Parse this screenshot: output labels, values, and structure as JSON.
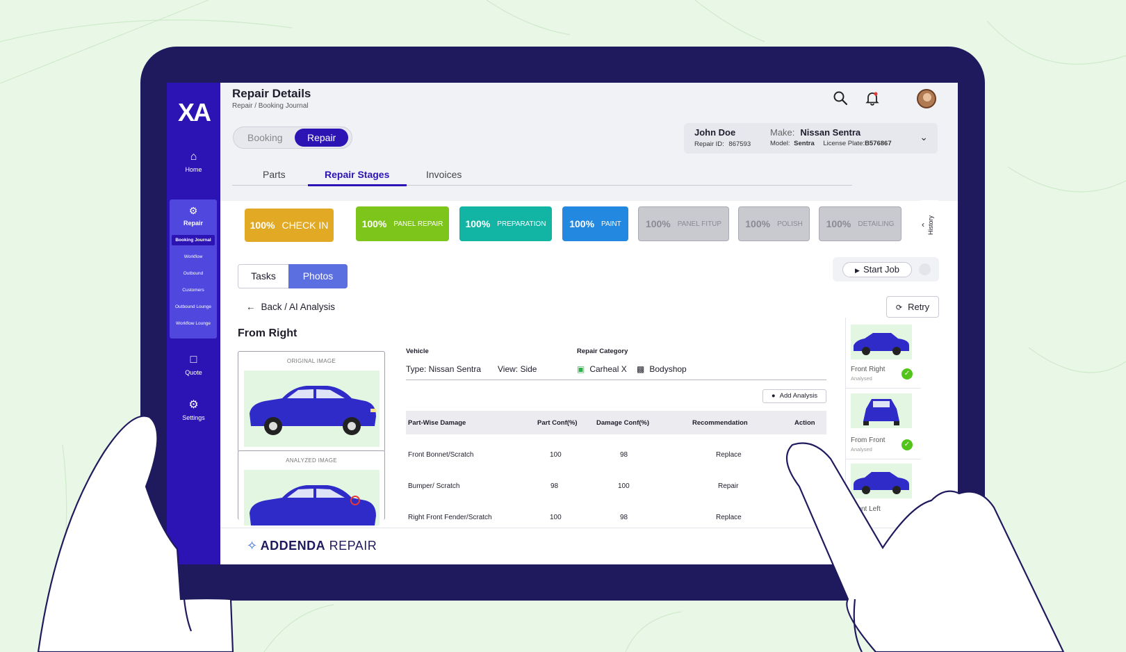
{
  "sidebar": {
    "logo": "XA",
    "home": "Home",
    "repair": "Repair",
    "repair_items": [
      "Booking Journal",
      "Workflow",
      "Outbound",
      "Customers",
      "Outbound Lounge",
      "Workflow Lounge"
    ],
    "quote": "Quote",
    "settings": "Settings"
  },
  "header": {
    "title": "Repair Details",
    "breadcrumb": "Repair / Booking Journal",
    "icons": [
      "search-icon",
      "bell-icon",
      "avatar"
    ]
  },
  "toggle": {
    "booking": "Booking",
    "repair": "Repair"
  },
  "customer": {
    "name": "John Doe",
    "repair_id_label": "Repair ID:",
    "repair_id": "867593",
    "make_label": "Make:",
    "make": "Nissan Sentra",
    "model_label": "Model:",
    "model": "Sentra",
    "plate_label": "License Plate:",
    "plate": "B576867"
  },
  "tabs": {
    "parts": "Parts",
    "stages": "Repair Stages",
    "invoices": "Invoices"
  },
  "stages": [
    {
      "pct": "100%",
      "label": "CHECK IN",
      "color": "#e2a924"
    },
    {
      "pct": "100%",
      "label": "PANEL REPAIR",
      "color": "#7ec51b"
    },
    {
      "pct": "100%",
      "label": "PREPARATION",
      "color": "#12b5a4"
    },
    {
      "pct": "100%",
      "label": "PAINT",
      "color": "#2288e0"
    },
    {
      "pct": "100%",
      "label": "PANEL FITUP",
      "color": "#c9c9d0"
    },
    {
      "pct": "100%",
      "label": "POLISH",
      "color": "#c9c9d0"
    },
    {
      "pct": "100%",
      "label": "DETAILING",
      "color": "#c9c9d0"
    }
  ],
  "history": "History",
  "segment": {
    "tasks": "Tasks",
    "photos": "Photos"
  },
  "start_job": "Start Job",
  "retry": "Retry",
  "back": "Back / AI Analysis",
  "view_title": "From Right",
  "original_caption": "ORIGINAL IMAGE",
  "analyzed_caption": "ANALYZED IMAGE",
  "vehicle": {
    "label": "Vehicle",
    "type": "Type: Nissan Sentra",
    "view": "View: Side"
  },
  "repair_category": {
    "label": "Repair Category",
    "carheal": "Carheal X",
    "bodyshop": "Bodyshop"
  },
  "add_analysis": "Add Analysis",
  "table": {
    "headers": [
      "Part-Wise Damage",
      "Part Conf(%)",
      "Damage Conf(%)",
      "Recommendation",
      "Action"
    ],
    "rows": [
      [
        "Front Bonnet/Scratch",
        "100",
        "98",
        "Replace"
      ],
      [
        "Bumper/ Scratch",
        "98",
        "100",
        "Repair"
      ],
      [
        "Right Front Fender/Scratch",
        "100",
        "98",
        "Replace"
      ]
    ]
  },
  "thumbnails": [
    {
      "name": "Front Right",
      "status": "Analysed"
    },
    {
      "name": "From Front",
      "status": "Analysed"
    },
    {
      "name": "Front Left",
      "status": ""
    }
  ],
  "footer": {
    "brand_bold": "ADDENDA",
    "brand_light": "REPAIR"
  },
  "colors": {
    "brand": "#2b14b3",
    "tablet": "#1f1a5e",
    "background": "#e9f8e6",
    "car": "#2f2bc9"
  }
}
